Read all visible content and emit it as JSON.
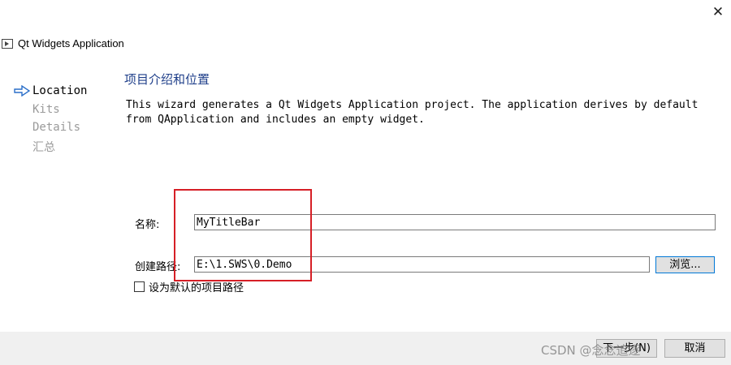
{
  "window": {
    "title": "Qt Widgets Application",
    "close_glyph": "✕",
    "close_icon": "close-icon",
    "app_icon": "app-window-icon"
  },
  "steps": [
    {
      "label": "Location",
      "active": true
    },
    {
      "label": "Kits",
      "active": false
    },
    {
      "label": "Details",
      "active": false
    },
    {
      "label": "汇总",
      "active": false
    }
  ],
  "page": {
    "title": "项目介绍和位置",
    "description": "This wizard generates a Qt Widgets Application project. The application derives by default\nfrom QApplication and includes an empty widget."
  },
  "form": {
    "name_label": "名称:",
    "name_value": "MyTitleBar",
    "path_label": "创建路径:",
    "path_value": "E:\\1.SWS\\0.Demo",
    "browse_label": "浏览...",
    "default_path_label": "设为默认的项目路径",
    "default_path_checked": false
  },
  "footer": {
    "next_label": "下一步(N)",
    "cancel_label": "取消",
    "watermark": "CSDN @念念追逐"
  },
  "colors": {
    "accent": "#0078d7",
    "title": "#1f3f8a",
    "highlight": "#d61f26",
    "footer_bg": "#f0f0f0"
  }
}
